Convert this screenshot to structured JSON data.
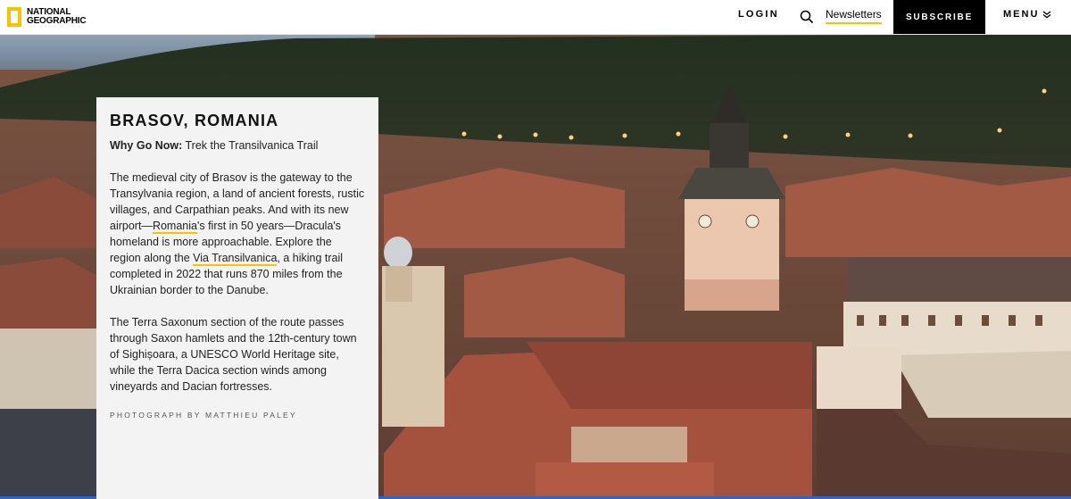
{
  "header": {
    "logo_line1": "NATIONAL",
    "logo_line2": "GEOGRAPHIC",
    "login": "LOGIN",
    "search_icon": "search-icon",
    "newsletters": "Newsletters",
    "subscribe": "SUBSCRIBE",
    "menu": "MENU",
    "menu_icon": "chevron-down-icon"
  },
  "card": {
    "title": "BRASOV, ROMANIA",
    "why_label": "Why Go Now:",
    "why_text": " Trek the Transilvanica Trail",
    "p1_a": "The medieval city of Brasov is the gateway to the Transylvania region, a land of ancient forests, rustic villages, and Carpathian peaks. And with its new airport—",
    "p1_link1": "Romania",
    "p1_b": "'s first in 50 years—Dracula's homeland is more approachable. Explore the region along the ",
    "p1_link2": "Via Transilvanica",
    "p1_c": ", a hiking trail completed in 2022 that runs 870 miles from the Ukrainian border to the Danube.",
    "p2": "The Terra Saxonum section of the route passes through Saxon hamlets and the 12th-century town of Sighișoara, a UNESCO World Heritage site, while the Terra Dacica section winds among vineyards and Dacian fortresses.",
    "credit": "PHOTOGRAPH BY MATTHIEU PALEY"
  },
  "colors": {
    "accent_yellow": "#f5c400",
    "subscribe_bg": "#000000",
    "bottom_bar": "#2f66c6"
  }
}
